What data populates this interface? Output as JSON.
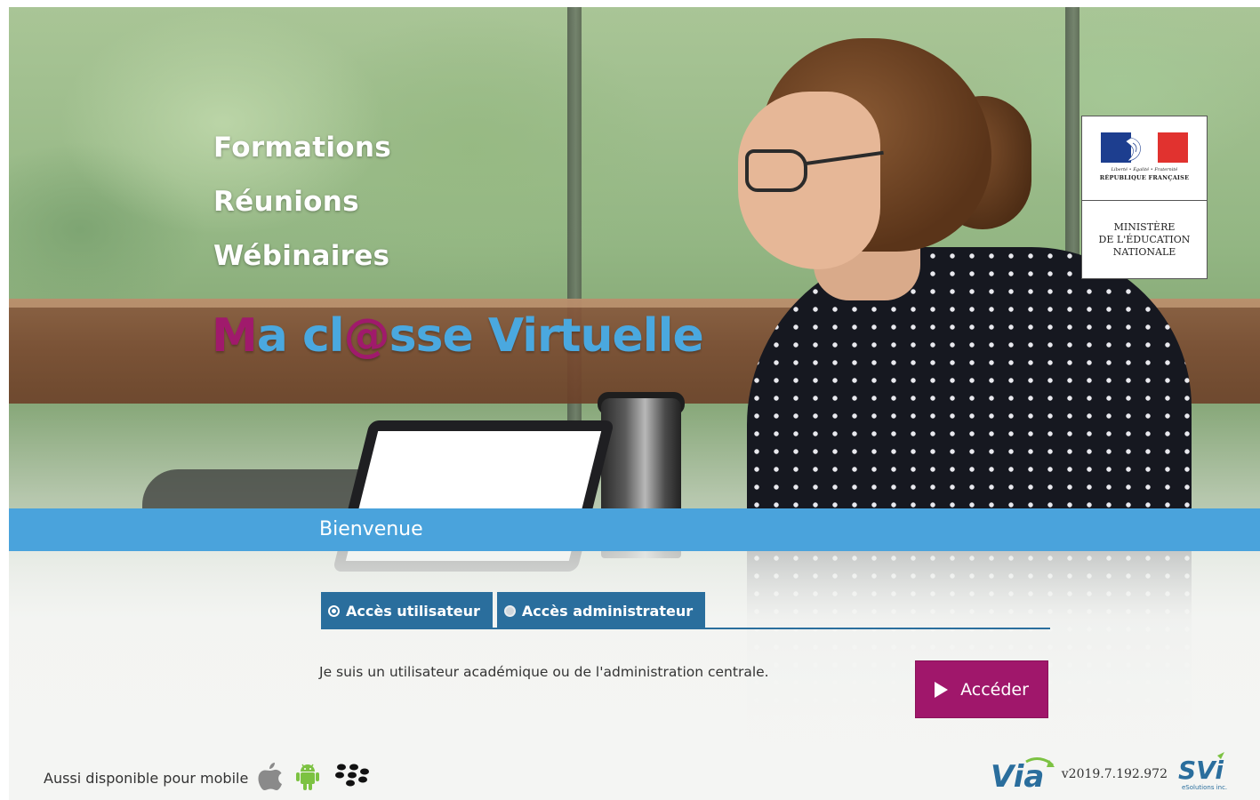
{
  "hero": {
    "taglines": [
      "Formations",
      "Réunions",
      "Wébinaires"
    ],
    "brand": {
      "part1": "M",
      "part2": "a cl",
      "part3": "@",
      "part4": "sse Virtuelle"
    }
  },
  "ministry": {
    "motto": "Liberté • Égalité • Fraternité",
    "republic": "RÉPUBLIQUE FRANÇAISE",
    "line1": "MINISTÈRE",
    "line2": "DE L'ÉDUCATION",
    "line3": "NATIONALE"
  },
  "welcome": {
    "title": "Bienvenue"
  },
  "tabs": [
    {
      "label": "Accès utilisateur",
      "selected": true
    },
    {
      "label": "Accès administrateur",
      "selected": false
    }
  ],
  "description": "Je suis un utilisateur académique ou de l'administration centrale.",
  "access_button": {
    "label": "Accéder",
    "icon": "play-icon"
  },
  "footer": {
    "mobile_text": "Aussi disponible pour mobile",
    "icons": [
      "apple-icon",
      "android-icon",
      "blackberry-icon"
    ],
    "via": "Via",
    "version": "v2019.7.192.972",
    "svi": "SVi",
    "svi_sub": "eSolutions inc."
  },
  "colors": {
    "brand_magenta": "#a01a6c",
    "brand_blue": "#4aa8df",
    "welcome_bar": "#4aa3dc",
    "tab_blue": "#2a6e9d",
    "button_magenta": "#a0176b"
  }
}
